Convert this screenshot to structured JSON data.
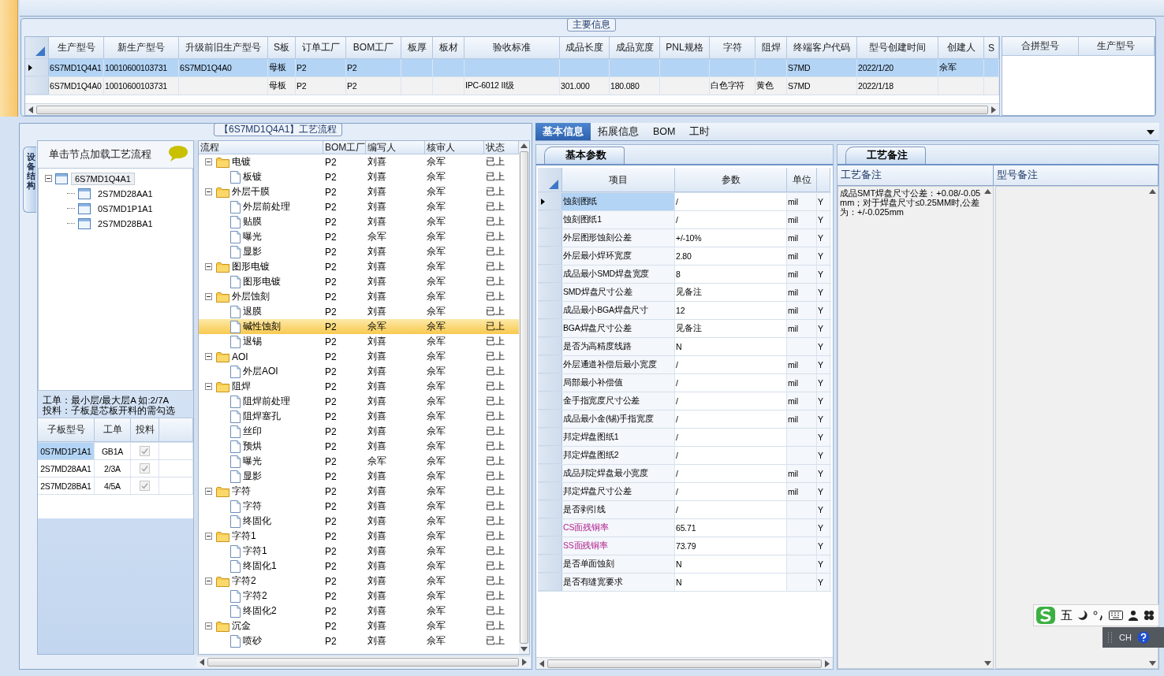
{
  "main_info": {
    "title": "主要信息",
    "grid": {
      "columns": [
        "生产型号",
        "新生产型号",
        "升级前旧生产型号",
        "S板",
        "订单工厂",
        "BOM工厂",
        "板厚",
        "板材",
        "验收标准",
        "成品长度",
        "成品宽度",
        "PNL规格",
        "字符",
        "阻焊",
        "终端客户代码",
        "型号创建时间",
        "创建人",
        "S"
      ],
      "rows": [
        {
          "selected": true,
          "cells": [
            "6S7MD1Q4A1",
            "10010600103731",
            "6S7MD1Q4A0",
            "母板",
            "P2",
            "P2",
            null,
            null,
            null,
            null,
            null,
            null,
            null,
            null,
            "S7MD",
            "2022/1/20",
            "佘军",
            null
          ]
        },
        {
          "selected": false,
          "cells": [
            "6S7MD1Q4A0",
            "10010600103731",
            null,
            "母板",
            "P2",
            "P2",
            null,
            null,
            "IPC-6012 II级",
            "301.000",
            "180.080",
            null,
            "白色字符",
            "黄色",
            "S7MD",
            "2022/1/18",
            null,
            null
          ]
        }
      ]
    },
    "merge_grid": {
      "columns": [
        "合拼型号",
        "生产型号"
      ]
    }
  },
  "process_panel": {
    "title": "【6S7MD1Q4A1】工艺流程",
    "side_tab": "设备结构",
    "tree_header": "单击节点加载工艺流程",
    "tree": [
      {
        "label": "6S7MD1Q4A1",
        "expanded": true,
        "selected": true,
        "children": [
          {
            "label": "2S7MD28AA1",
            "selected": false
          },
          {
            "label": "0S7MD1P1A1",
            "selected": false
          },
          {
            "label": "2S7MD28BA1",
            "selected": false
          }
        ]
      }
    ],
    "hints": [
      "工单：最小层/最大层A 如:2/7A",
      "投料：子板是芯板开料的需勾选"
    ],
    "sub_grid": {
      "columns": [
        "子板型号",
        "工单",
        "投料"
      ],
      "rows": [
        {
          "cells": [
            "0S7MD1P1A1",
            "GB1A"
          ],
          "checked": true,
          "disabled": true,
          "selected": true
        },
        {
          "cells": [
            "2S7MD28AA1",
            "2/3A"
          ],
          "checked": true,
          "disabled": true,
          "selected": false
        },
        {
          "cells": [
            "2S7MD28BA1",
            "4/5A"
          ],
          "checked": true,
          "disabled": true,
          "selected": false
        }
      ]
    },
    "flow": {
      "tree_column": "流程",
      "columns": [
        "BOM工厂",
        "编写人",
        "核审人",
        "状态"
      ],
      "rows": [
        {
          "label": "电镀",
          "kind": "folder",
          "expanded": true,
          "selected": false,
          "cells": [
            "P2",
            "刘喜",
            "佘军",
            "已上"
          ],
          "children": [
            {
              "label": "板镀",
              "kind": "file",
              "selected": false,
              "cells": [
                "P2",
                "刘喜",
                "佘军",
                "已上"
              ]
            }
          ]
        },
        {
          "label": "外层干膜",
          "kind": "folder",
          "expanded": true,
          "selected": false,
          "cells": [
            "P2",
            "刘喜",
            "佘军",
            "已上"
          ],
          "children": [
            {
              "label": "外层前处理",
              "kind": "file",
              "selected": false,
              "cells": [
                "P2",
                "刘喜",
                "佘军",
                "已上"
              ]
            },
            {
              "label": "贴膜",
              "kind": "file",
              "selected": false,
              "cells": [
                "P2",
                "刘喜",
                "佘军",
                "已上"
              ]
            },
            {
              "label": "曝光",
              "kind": "file",
              "selected": false,
              "cells": [
                "P2",
                "佘军",
                "佘军",
                "已上"
              ]
            },
            {
              "label": "显影",
              "kind": "file",
              "selected": false,
              "cells": [
                "P2",
                "刘喜",
                "佘军",
                "已上"
              ]
            }
          ]
        },
        {
          "label": "图形电镀",
          "kind": "folder",
          "expanded": true,
          "selected": false,
          "cells": [
            "P2",
            "刘喜",
            "佘军",
            "已上"
          ],
          "children": [
            {
              "label": "图形电镀",
              "kind": "file",
              "selected": false,
              "cells": [
                "P2",
                "刘喜",
                "佘军",
                "已上"
              ]
            }
          ]
        },
        {
          "label": "外层蚀刻",
          "kind": "folder",
          "expanded": true,
          "selected": false,
          "cells": [
            "P2",
            "刘喜",
            "佘军",
            "已上"
          ],
          "children": [
            {
              "label": "退膜",
              "kind": "file",
              "selected": false,
              "cells": [
                "P2",
                "刘喜",
                "佘军",
                "已上"
              ]
            },
            {
              "label": "碱性蚀刻",
              "kind": "file",
              "selected": true,
              "cells": [
                "P2",
                "佘军",
                "佘军",
                "已上"
              ]
            },
            {
              "label": "退锡",
              "kind": "file",
              "selected": false,
              "cells": [
                "P2",
                "刘喜",
                "佘军",
                "已上"
              ]
            }
          ]
        },
        {
          "label": "AOI",
          "kind": "folder",
          "expanded": true,
          "selected": false,
          "cells": [
            "P2",
            "刘喜",
            "佘军",
            "已上"
          ],
          "children": [
            {
              "label": "外层AOI",
              "kind": "file",
              "selected": false,
              "cells": [
                "P2",
                "刘喜",
                "佘军",
                "已上"
              ]
            }
          ]
        },
        {
          "label": "阻焊",
          "kind": "folder",
          "expanded": true,
          "selected": false,
          "cells": [
            "P2",
            "刘喜",
            "佘军",
            "已上"
          ],
          "children": [
            {
              "label": "阻焊前处理",
              "kind": "file",
              "selected": false,
              "cells": [
                "P2",
                "刘喜",
                "佘军",
                "已上"
              ]
            },
            {
              "label": "阻焊塞孔",
              "kind": "file",
              "selected": false,
              "cells": [
                "P2",
                "刘喜",
                "佘军",
                "已上"
              ]
            },
            {
              "label": "丝印",
              "kind": "file",
              "selected": false,
              "cells": [
                "P2",
                "刘喜",
                "佘军",
                "已上"
              ]
            },
            {
              "label": "预烘",
              "kind": "file",
              "selected": false,
              "cells": [
                "P2",
                "刘喜",
                "佘军",
                "已上"
              ]
            },
            {
              "label": "曝光",
              "kind": "file",
              "selected": false,
              "cells": [
                "P2",
                "佘军",
                "佘军",
                "已上"
              ]
            },
            {
              "label": "显影",
              "kind": "file",
              "selected": false,
              "cells": [
                "P2",
                "刘喜",
                "佘军",
                "已上"
              ]
            }
          ]
        },
        {
          "label": "字符",
          "kind": "folder",
          "expanded": true,
          "selected": false,
          "cells": [
            "P2",
            "刘喜",
            "佘军",
            "已上"
          ],
          "children": [
            {
              "label": "字符",
              "kind": "file",
              "selected": false,
              "cells": [
                "P2",
                "刘喜",
                "佘军",
                "已上"
              ]
            },
            {
              "label": "终固化",
              "kind": "file",
              "selected": false,
              "cells": [
                "P2",
                "刘喜",
                "佘军",
                "已上"
              ]
            }
          ]
        },
        {
          "label": "字符1",
          "kind": "folder",
          "expanded": true,
          "selected": false,
          "cells": [
            "P2",
            "刘喜",
            "佘军",
            "已上"
          ],
          "children": [
            {
              "label": "字符1",
              "kind": "file",
              "selected": false,
              "cells": [
                "P2",
                "刘喜",
                "佘军",
                "已上"
              ]
            },
            {
              "label": "终固化1",
              "kind": "file",
              "selected": false,
              "cells": [
                "P2",
                "刘喜",
                "佘军",
                "已上"
              ]
            }
          ]
        },
        {
          "label": "字符2",
          "kind": "folder",
          "expanded": true,
          "selected": false,
          "cells": [
            "P2",
            "刘喜",
            "佘军",
            "已上"
          ],
          "children": [
            {
              "label": "字符2",
              "kind": "file",
              "selected": false,
              "cells": [
                "P2",
                "刘喜",
                "佘军",
                "已上"
              ]
            },
            {
              "label": "终固化2",
              "kind": "file",
              "selected": false,
              "cells": [
                "P2",
                "刘喜",
                "佘军",
                "已上"
              ]
            }
          ]
        },
        {
          "label": "沉金",
          "kind": "folder",
          "expanded": true,
          "selected": false,
          "cells": [
            "P2",
            "刘喜",
            "佘军",
            "已上"
          ],
          "children": [
            {
              "label": "喷砂",
              "kind": "file",
              "selected": false,
              "cells": [
                "P2",
                "刘喜",
                "佘军",
                "已上"
              ]
            }
          ]
        }
      ]
    }
  },
  "detail_panel": {
    "tabs": [
      {
        "label": "基本信息",
        "selected": true
      },
      {
        "label": "拓展信息",
        "selected": false
      },
      {
        "label": "BOM",
        "selected": false
      },
      {
        "label": "工时",
        "selected": false
      }
    ],
    "params": {
      "tab": "基本参数",
      "columns": [
        "项目",
        "参数",
        "单位"
      ],
      "rows": [
        {
          "item": "蚀刻图纸",
          "value": "/",
          "unit": "mil",
          "flag": "Y",
          "selected": true,
          "highlighted": false
        },
        {
          "item": "蚀刻图纸1",
          "value": "/",
          "unit": "mil",
          "flag": "Y",
          "selected": false,
          "highlighted": false
        },
        {
          "item": "外层图形蚀刻公差",
          "value": "+/-10%",
          "unit": "mil",
          "flag": "Y",
          "selected": false,
          "highlighted": false
        },
        {
          "item": "外层最小焊环宽度",
          "value": "2.80",
          "unit": "mil",
          "flag": "Y",
          "selected": false,
          "highlighted": false
        },
        {
          "item": "成品最小SMD焊盘宽度",
          "value": "8",
          "unit": "mil",
          "flag": "Y",
          "selected": false,
          "highlighted": false
        },
        {
          "item": "SMD焊盘尺寸公差",
          "value": "见备注",
          "unit": "mil",
          "flag": "Y",
          "selected": false,
          "highlighted": false
        },
        {
          "item": "成品最小BGA焊盘尺寸",
          "value": "12",
          "unit": "mil",
          "flag": "Y",
          "selected": false,
          "highlighted": false
        },
        {
          "item": "BGA焊盘尺寸公差",
          "value": "见备注",
          "unit": "mil",
          "flag": "Y",
          "selected": false,
          "highlighted": false
        },
        {
          "item": "是否为高精度线路",
          "value": "N",
          "flag": "Y",
          "selected": false,
          "highlighted": false
        },
        {
          "item": "外层通道补偿后最小宽度",
          "value": "/",
          "unit": "mil",
          "flag": "Y",
          "selected": false,
          "highlighted": false
        },
        {
          "item": "局部最小补偿值",
          "value": "/",
          "unit": "mil",
          "flag": "Y",
          "selected": false,
          "highlighted": false
        },
        {
          "item": "金手指宽度尺寸公差",
          "value": "/",
          "unit": "mil",
          "flag": "Y",
          "selected": false,
          "highlighted": false
        },
        {
          "item": "成品最小金(锡)手指宽度",
          "value": "/",
          "unit": "mil",
          "flag": "Y",
          "selected": false,
          "highlighted": false
        },
        {
          "item": "邦定焊盘图纸1",
          "value": "/",
          "flag": "Y",
          "selected": false,
          "highlighted": false
        },
        {
          "item": "邦定焊盘图纸2",
          "value": "/",
          "flag": "Y",
          "selected": false,
          "highlighted": false
        },
        {
          "item": "成品邦定焊盘最小宽度",
          "value": "/",
          "unit": "mil",
          "flag": "Y",
          "selected": false,
          "highlighted": false
        },
        {
          "item": "邦定焊盘尺寸公差",
          "value": "/",
          "unit": "mil",
          "flag": "Y",
          "selected": false,
          "highlighted": false
        },
        {
          "item": "是否剥引线",
          "value": "/",
          "flag": "Y",
          "selected": false,
          "highlighted": false
        },
        {
          "item": "CS面残铜率",
          "value": "65.71",
          "flag": "Y",
          "selected": false,
          "highlighted": true
        },
        {
          "item": "SS面残铜率",
          "value": "73.79",
          "flag": "Y",
          "selected": false,
          "highlighted": true
        },
        {
          "item": "是否单面蚀刻",
          "value": "N",
          "flag": "Y",
          "selected": false,
          "highlighted": false
        },
        {
          "item": "是否有缝宽要求",
          "value": "N",
          "flag": "Y",
          "selected": false,
          "highlighted": false
        }
      ]
    },
    "notes": {
      "tab": "工艺备注",
      "columns": [
        "工艺备注",
        "型号备注"
      ],
      "process_note": "成品SMT焊盘尺寸公差：+0.08/-0.05mm；对于焊盘尺寸≤0.25MM时,公差为：+/-0.025mm"
    }
  },
  "ime_bar": {
    "mode": "五",
    "language": "CH"
  }
}
